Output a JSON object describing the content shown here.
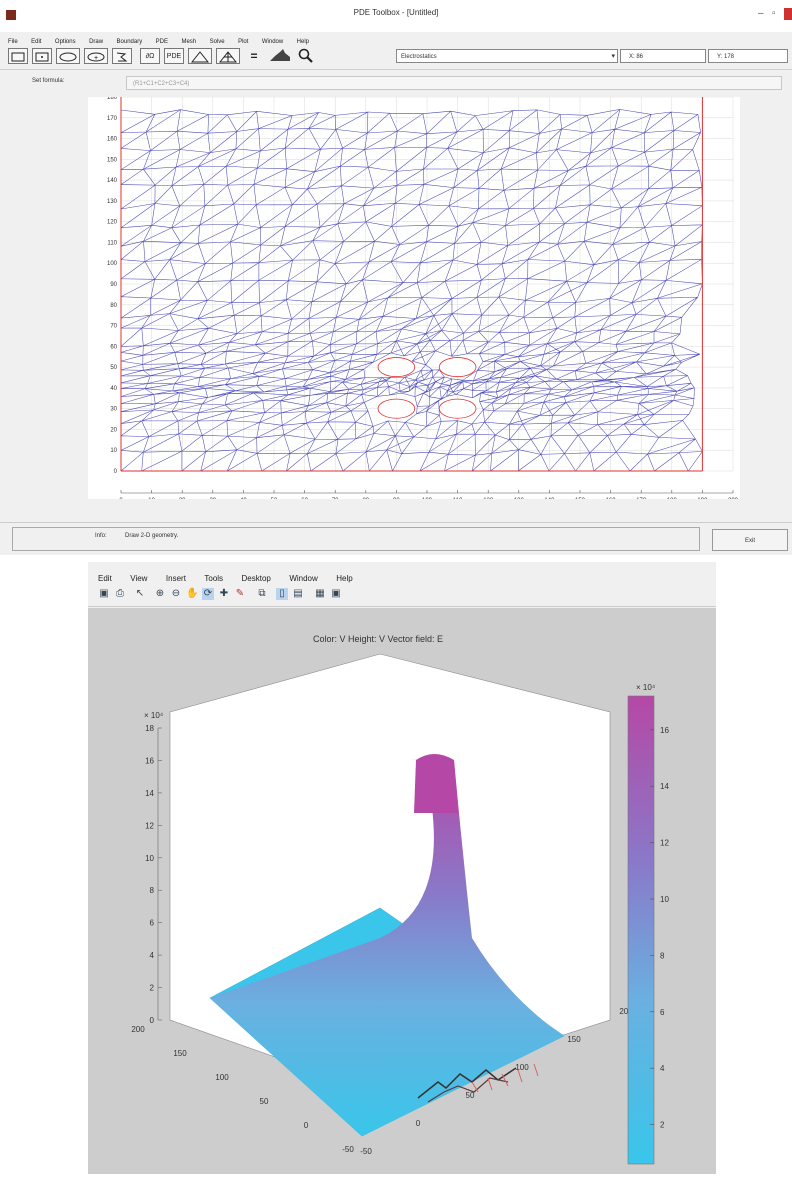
{
  "window": {
    "title": "PDE Toolbox - [Untitled]",
    "menu": [
      "File",
      "Edit",
      "Options",
      "Draw",
      "Boundary",
      "PDE",
      "Mesh",
      "Solve",
      "Plot",
      "Window",
      "Help"
    ]
  },
  "toolbar": {
    "buttons": [
      {
        "label": "",
        "icon": "rectangle-icon"
      },
      {
        "label": "",
        "icon": "square-center-icon"
      },
      {
        "label": "",
        "icon": "ellipse-icon"
      },
      {
        "label": "",
        "icon": "ellipse-center-icon"
      },
      {
        "label": "",
        "icon": "polygon-icon"
      },
      {
        "label": "∂Ω",
        "icon": "boundary-icon"
      },
      {
        "label": "PDE",
        "icon": "pde-icon"
      },
      {
        "label": "",
        "icon": "triangle-mesh-icon"
      },
      {
        "label": "",
        "icon": "refine-mesh-icon"
      },
      {
        "label": "=",
        "icon": "solve-icon"
      },
      {
        "label": "",
        "icon": "plot-icon"
      },
      {
        "label": "",
        "icon": "zoom-icon"
      }
    ],
    "mode_select": "Electrostatics",
    "x_readout": "X: 86",
    "y_readout": "Y: 178"
  },
  "set_formula": {
    "label": "Set formula:",
    "value": "(R1+C1+C2+C3+C4)"
  },
  "info": {
    "label": "Info:",
    "text": "Draw 2-D geometry.",
    "exit_label": "Exit"
  },
  "mesh_plot": {
    "x_ticks": [
      "0",
      "10",
      "20",
      "30",
      "40",
      "50",
      "60",
      "70",
      "80",
      "90",
      "100",
      "110",
      "120",
      "130",
      "140",
      "150",
      "160",
      "170",
      "180",
      "190",
      "200"
    ],
    "y_ticks": [
      "0",
      "10",
      "20",
      "30",
      "40",
      "50",
      "60",
      "70",
      "80",
      "90",
      "100",
      "110",
      "120",
      "130",
      "140",
      "150",
      "160",
      "170",
      "180"
    ],
    "x_range": [
      0,
      200
    ],
    "y_range": [
      0,
      180
    ],
    "domain_x": [
      0,
      190
    ],
    "holes": [
      [
        90,
        50
      ],
      [
        110,
        50
      ],
      [
        90,
        30
      ],
      [
        110,
        30
      ]
    ],
    "edge_color": "#4a4ab8",
    "boundary_color": "#e03030"
  },
  "figure_window": {
    "menu": [
      "Edit",
      "View",
      "Insert",
      "Tools",
      "Desktop",
      "Window",
      "Help"
    ]
  },
  "surface_plot": {
    "title": "Color: V  Height: V  Vector field: E",
    "z_exponent": "× 10⁴",
    "z_ticks": [
      "0",
      "2",
      "4",
      "6",
      "8",
      "10",
      "12",
      "14",
      "16",
      "18"
    ],
    "y_ticks": [
      "200",
      "150",
      "100",
      "50",
      "0",
      "-50"
    ],
    "x_ticks": [
      "-50",
      "0",
      "50",
      "100",
      "150",
      "200"
    ],
    "colorbar_exponent": "× 10⁴",
    "colorbar_ticks": [
      "2",
      "4",
      "6",
      "8",
      "10",
      "12",
      "14",
      "16"
    ],
    "colormap": [
      "#39c6ea",
      "#6ab0e0",
      "#8a78c8",
      "#b548a6"
    ]
  }
}
